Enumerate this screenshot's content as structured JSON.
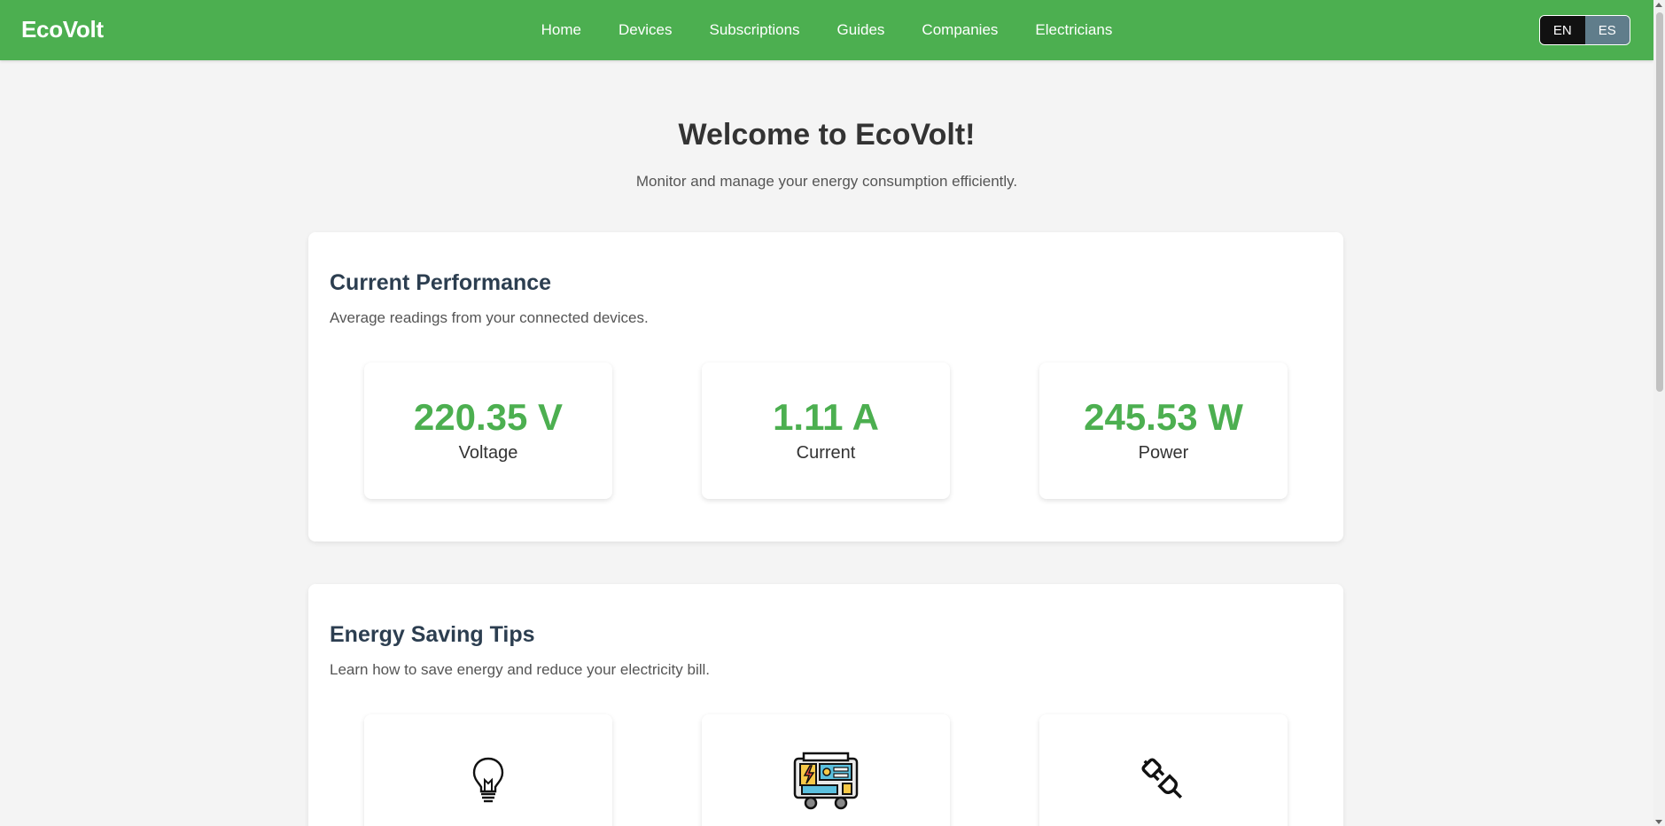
{
  "navbar": {
    "brand": "EcoVolt",
    "links": [
      "Home",
      "Devices",
      "Subscriptions",
      "Guides",
      "Companies",
      "Electricians"
    ],
    "lang": {
      "active": "EN",
      "inactive": "ES"
    },
    "color": "#4caf50"
  },
  "hero": {
    "title": "Welcome to EcoVolt!",
    "subtitle": "Monitor and manage your energy consumption efficiently."
  },
  "performance": {
    "title": "Current Performance",
    "description": "Average readings from your connected devices.",
    "metrics": [
      {
        "value": "220.35 V",
        "label": "Voltage"
      },
      {
        "value": "1.11 A",
        "label": "Current"
      },
      {
        "value": "245.53 W",
        "label": "Power"
      }
    ]
  },
  "tips": {
    "title": "Energy Saving Tips",
    "description": "Learn how to save energy and reduce your electricity bill.",
    "cards": [
      {
        "icon": "lightbulb-icon"
      },
      {
        "icon": "generator-icon"
      },
      {
        "icon": "plug-icon"
      }
    ]
  }
}
